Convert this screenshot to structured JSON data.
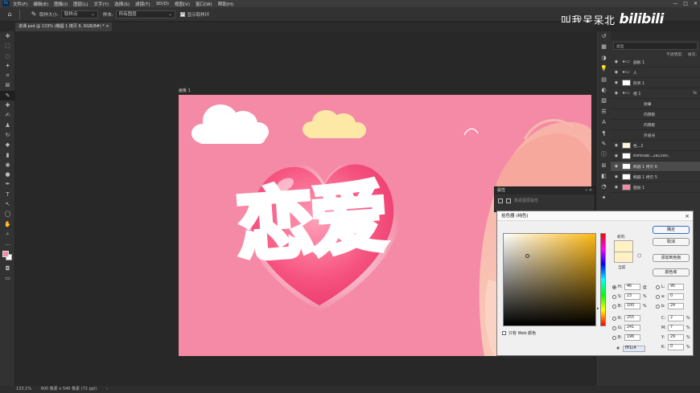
{
  "menubar": {
    "logo": "Ps",
    "items": [
      "文件(F)",
      "编辑(E)",
      "图像(I)",
      "图层(L)",
      "文字(Y)",
      "选择(S)",
      "滤镜(T)",
      "3D(D)",
      "视图(V)",
      "窗口(W)",
      "帮助(H)"
    ],
    "controls": [
      "—",
      "□",
      "✕"
    ]
  },
  "optbar": {
    "sample_size_label": "取样大小:",
    "sample_size_value": "取样点",
    "sample_label": "样本:",
    "sample_value": "所有图层",
    "show_ring_label": "显示取样环"
  },
  "watermark": {
    "text": "叫我呆呆北",
    "logo": "bilibili"
  },
  "document_tab": {
    "label": "讲课.psd @ 133% (椭圆 1 拷贝 6, RGB/8#) * ×"
  },
  "artboard": {
    "label": "画板 1"
  },
  "canvas_art": {
    "title": "恋爱",
    "colors": {
      "background": "#f48aa6",
      "heart": "#f44e7e",
      "cloud_white": "#ffffff",
      "cloud_yellow": "#fde8a6"
    }
  },
  "statusbar": {
    "zoom": "133.1%",
    "doc_size": "900 像素 x 540 像素 (72 ppi)",
    "arrow": "›"
  },
  "toolbar": {
    "tools": [
      "move-tool",
      "marquee-tool",
      "lasso-tool",
      "magic-wand-tool",
      "crop-tool",
      "frame-tool",
      "eyedropper-tool",
      "healing-brush-tool",
      "brush-tool",
      "clone-stamp-tool",
      "history-brush-tool",
      "eraser-tool",
      "gradient-tool",
      "blur-tool",
      "dodge-tool",
      "pen-tool",
      "type-tool",
      "path-select-tool",
      "shape-tool",
      "hand-tool",
      "zoom-tool",
      "more-tools"
    ],
    "tool_glyphs": [
      "✥",
      "⬚",
      "◌",
      "✦",
      "⌗",
      "⊠",
      "✎",
      "✚",
      "✍",
      "♟",
      "↻",
      "◆",
      "▮",
      "◉",
      "●",
      "✒",
      "T",
      "↖",
      "◯",
      "✋",
      "⌕",
      "…"
    ],
    "foreground_color": "#f48aa6",
    "background_color": "#ffffff"
  },
  "layers": {
    "rows": [
      {
        "name": "画板 1",
        "type": "folder"
      },
      {
        "name": "人",
        "type": "folder"
      },
      {
        "name": "形状 1",
        "type": "layer"
      },
      {
        "name": "组 1",
        "type": "folder",
        "fx": "fx"
      },
      {
        "name": "效果",
        "type": "effect"
      },
      {
        "name": "内阴影",
        "type": "effect"
      },
      {
        "name": "内阴影",
        "type": "effect"
      },
      {
        "name": "外发光",
        "type": "effect"
      },
      {
        "name": "色...2",
        "type": "adjust"
      },
      {
        "name": "b9fd5ab...2a1590..",
        "type": "image"
      },
      {
        "name": "椭圆 1 拷贝 6",
        "type": "shape",
        "selected": true
      },
      {
        "name": "椭圆 1 拷贝 5",
        "type": "shape"
      },
      {
        "name": "图层 1",
        "type": "fill"
      }
    ],
    "filter_label": "类型",
    "opacity_label": "不透明度:",
    "fill_label": "填充:"
  },
  "properties": {
    "title": "属性",
    "row_text": "像素图层属性"
  },
  "color_picker": {
    "title": "拾色器 (纯色)",
    "close": "×",
    "new_label": "新的",
    "current_label": "当前",
    "ok": "确定",
    "cancel": "取消",
    "add_swatch": "添加到色板",
    "color_library": "颜色库",
    "hsb": {
      "H": "46",
      "S": "23",
      "B": "100"
    },
    "rgb": {
      "R": "255",
      "G": "241",
      "B": "196"
    },
    "lab": {
      "L": "95",
      "a": "0",
      "b": "24"
    },
    "cmyk": {
      "C": "2",
      "M": "7",
      "Y": "29",
      "K": "0"
    },
    "hex_label": "#",
    "hex": "fff1c4",
    "units": {
      "deg": "度",
      "pct": "%"
    },
    "web_only": "只有 Web 颜色",
    "swatch_color": "#fff1c4"
  }
}
